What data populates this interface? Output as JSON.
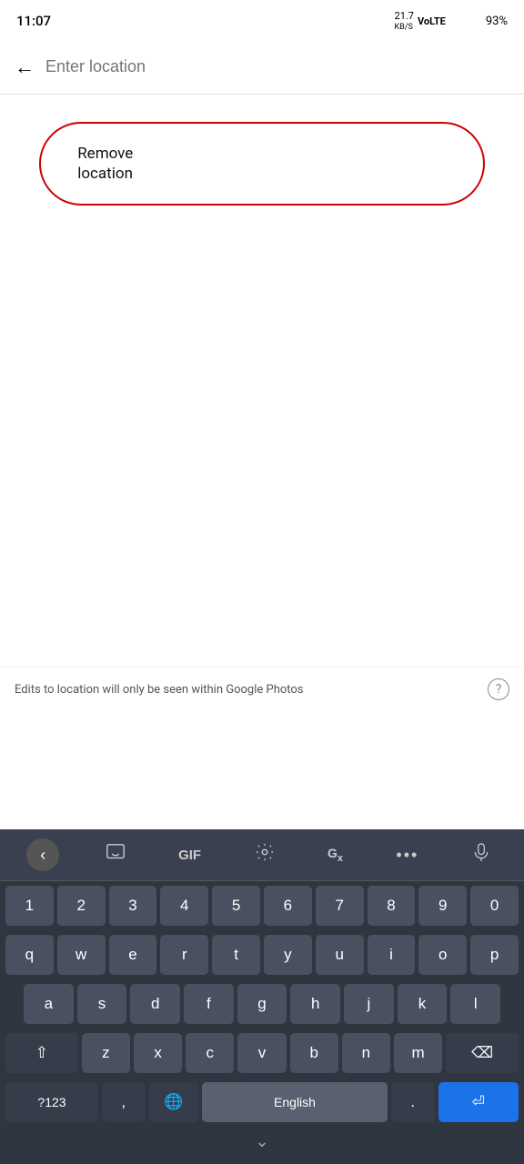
{
  "statusBar": {
    "time": "11:07",
    "speed": "21.7",
    "speedUnit": "KB/S",
    "battery": "93%"
  },
  "topBar": {
    "backLabel": "←",
    "inputPlaceholder": "Enter location"
  },
  "content": {
    "removeLocationLabel": "Remove\nlocation"
  },
  "infoBar": {
    "text": "Edits to location will only be seen within Google Photos",
    "helpIcon": "?"
  },
  "keyboard": {
    "toolbar": {
      "backBtn": "‹",
      "emojiBtn": "⊡",
      "gifBtn": "GIF",
      "settingsBtn": "⚙",
      "translateBtn": "Gx",
      "moreBtn": "•••",
      "micBtn": "🎤"
    },
    "row1": [
      "1",
      "2",
      "3",
      "4",
      "5",
      "6",
      "7",
      "8",
      "9",
      "0"
    ],
    "row2": [
      "q",
      "w",
      "e",
      "r",
      "t",
      "y",
      "u",
      "i",
      "o",
      "p"
    ],
    "row3": [
      "a",
      "s",
      "d",
      "f",
      "g",
      "h",
      "j",
      "k",
      "l"
    ],
    "row4": [
      "z",
      "x",
      "c",
      "v",
      "b",
      "n",
      "m"
    ],
    "row5": {
      "sym": "?123",
      "comma": ",",
      "glob": "🌐",
      "space": "English",
      "period": ".",
      "enter": "⏎"
    },
    "chevron": "⌄"
  }
}
